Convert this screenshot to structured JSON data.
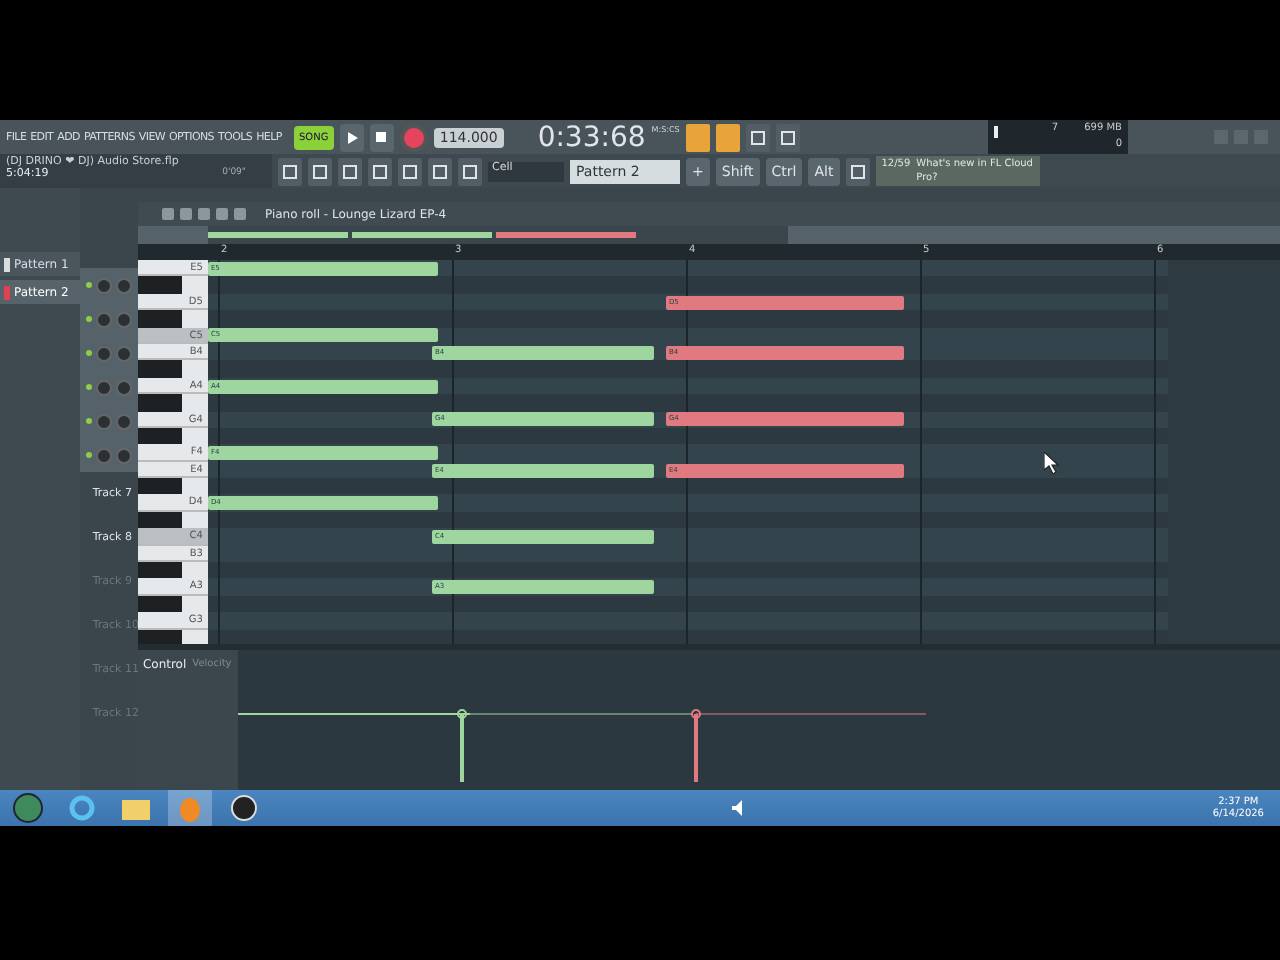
{
  "menu": [
    "FILE",
    "EDIT",
    "ADD",
    "PATTERNS",
    "VIEW",
    "OPTIONS",
    "TOOLS",
    "HELP"
  ],
  "transport": {
    "mode": "SONG",
    "tempo": "114.000",
    "time_unit": "M:S:CS",
    "time": "0:33:68"
  },
  "memory": {
    "voices": "7",
    "ram": "699 MB",
    "cpu": "0",
    "level": 0.04
  },
  "hint": {
    "title": "(DJ DRINO ❤ DJ) Audio Store.flp",
    "elapsed": "5:04:19",
    "duration": "0'09\""
  },
  "snap": "Cell",
  "pattern": "Pattern 2",
  "pattern_add": "+",
  "modifiers": [
    "Shift",
    "Ctrl",
    "Alt"
  ],
  "news": {
    "count": "12/59",
    "text": "What's new in FL Cloud Pro?"
  },
  "browser": {
    "items": [
      {
        "label": "Pattern 1",
        "selected": false
      },
      {
        "label": "Pattern 2",
        "selected": true
      }
    ]
  },
  "channels": [
    {
      "on": true
    },
    {
      "on": true
    },
    {
      "on": true
    },
    {
      "on": true
    },
    {
      "on": true
    },
    {
      "on": true
    }
  ],
  "tracks": [
    {
      "label": "Track 7",
      "dimmed": false
    },
    {
      "label": "Track 8",
      "dimmed": false
    },
    {
      "label": "Track 9",
      "dimmed": true
    },
    {
      "label": "Track 10",
      "dimmed": true
    },
    {
      "label": "Track 11",
      "dimmed": true
    },
    {
      "label": "Track 12",
      "dimmed": true
    }
  ],
  "piano_roll": {
    "title": "Piano roll - Lounge Lizard EP-4",
    "ruler": [
      "2",
      "3",
      "4",
      "5",
      "6"
    ],
    "keys": [
      {
        "label": "E5",
        "kind": "white"
      },
      {
        "kind": "black"
      },
      {
        "label": "D5",
        "kind": "white"
      },
      {
        "kind": "black"
      },
      {
        "label": "C5",
        "kind": "c"
      },
      {
        "label": "B4",
        "kind": "white"
      },
      {
        "kind": "black"
      },
      {
        "label": "A4",
        "kind": "white"
      },
      {
        "kind": "black"
      },
      {
        "label": "G4",
        "kind": "white"
      },
      {
        "kind": "black"
      },
      {
        "label": "F4",
        "kind": "white"
      },
      {
        "label": "E4",
        "kind": "white"
      },
      {
        "kind": "black"
      },
      {
        "label": "D4",
        "kind": "white"
      },
      {
        "kind": "black"
      },
      {
        "label": "C4",
        "kind": "c"
      },
      {
        "label": "B3",
        "kind": "white"
      },
      {
        "kind": "black"
      },
      {
        "label": "A3",
        "kind": "white"
      },
      {
        "kind": "black"
      },
      {
        "label": "G3",
        "kind": "white"
      },
      {
        "kind": "black"
      }
    ],
    "columns": [
      {
        "color": "#9fd6a0",
        "notes": [
          {
            "label": "E5"
          },
          {
            "label": "C5"
          },
          {
            "label": "A4"
          },
          {
            "label": "F4"
          },
          {
            "label": "D4"
          }
        ]
      },
      {
        "color": "#9fd6a0",
        "notes": [
          {
            "label": "B4"
          },
          {
            "label": "G4"
          },
          {
            "label": "E4"
          },
          {
            "label": "C4"
          },
          {
            "label": "A3"
          }
        ]
      },
      {
        "color": "#e07a80",
        "notes": [
          {
            "label": "D5"
          },
          {
            "label": "B4"
          },
          {
            "label": "G4"
          },
          {
            "label": "E4"
          }
        ]
      }
    ],
    "control": {
      "label": "Control",
      "parameter": "Velocity"
    }
  },
  "taskbar": {
    "time": "2:37 PM",
    "date": "6/14/2026"
  }
}
